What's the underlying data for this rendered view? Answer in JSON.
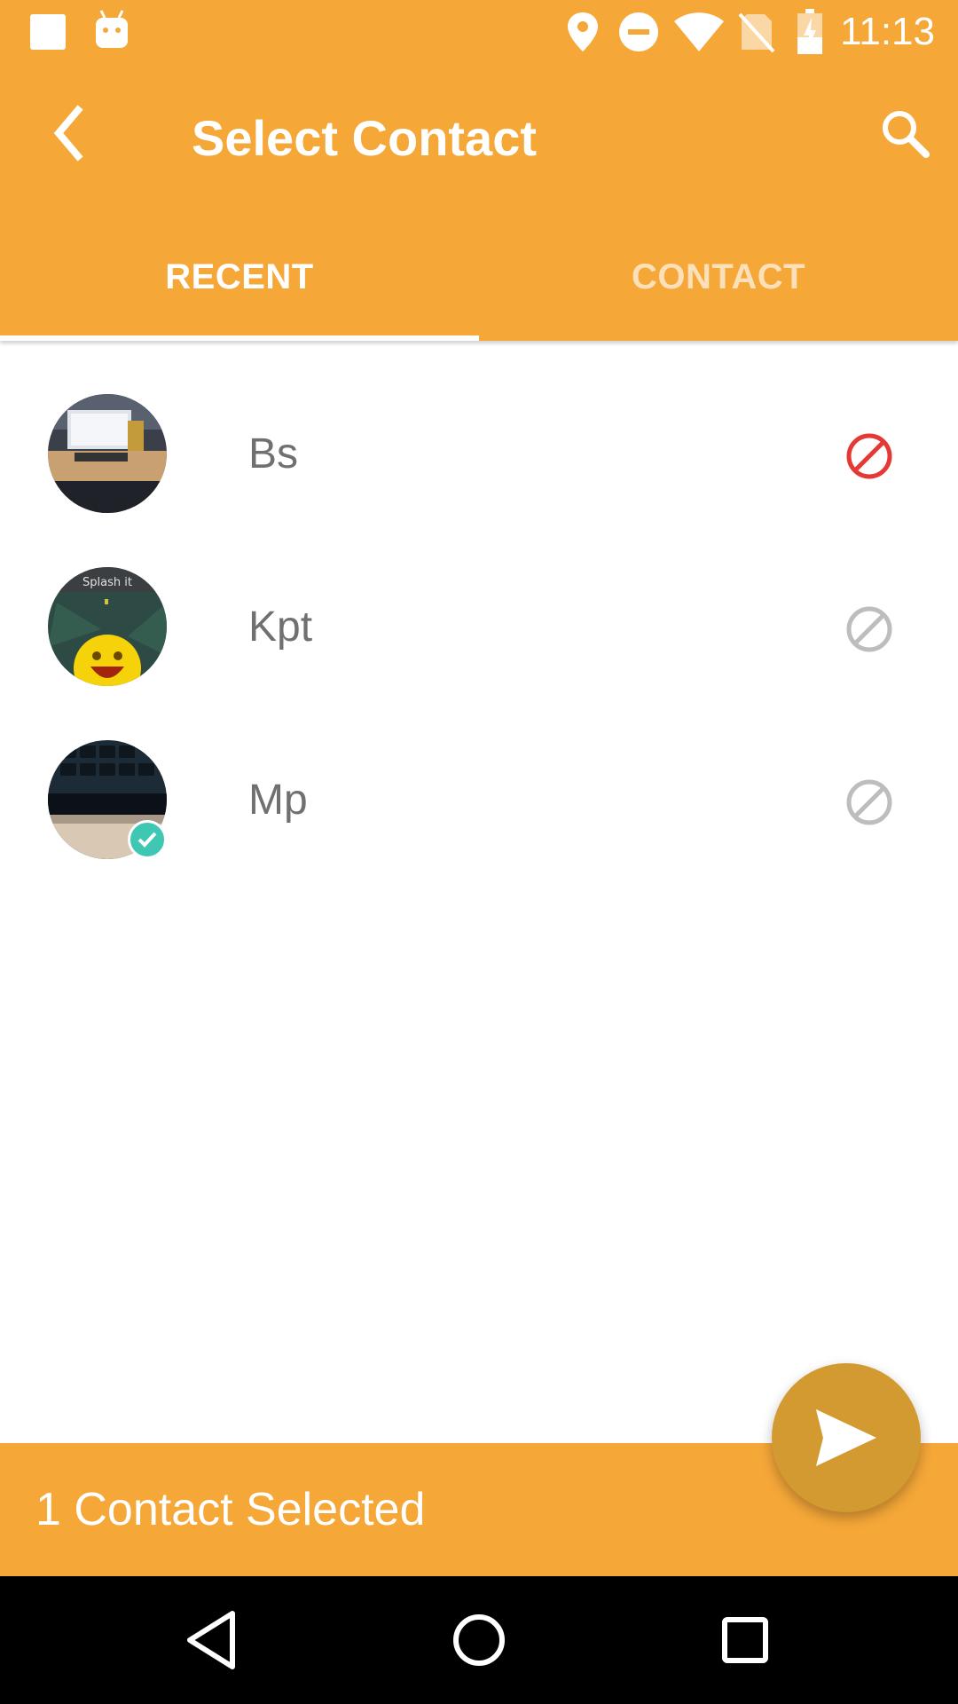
{
  "status_bar": {
    "time": "11:13",
    "icons": [
      "square-notification-icon",
      "android-icon",
      "location-icon",
      "do-not-disturb-icon",
      "wifi-icon",
      "no-sim-icon",
      "battery-charging-icon"
    ]
  },
  "toolbar": {
    "title": "Select Contact",
    "back_icon": "back-arrow-icon",
    "search_icon": "search-icon"
  },
  "tabs": [
    {
      "label": "RECENT",
      "active": true
    },
    {
      "label": "CONTACT",
      "active": false
    }
  ],
  "contacts": [
    {
      "name": "Bs",
      "blocked": true,
      "selected": false,
      "avatar": "desk-photo"
    },
    {
      "name": "Kpt",
      "blocked": false,
      "selected": false,
      "avatar": "emoji-photo"
    },
    {
      "name": "Mp",
      "blocked": false,
      "selected": true,
      "avatar": "keyboard-photo"
    }
  ],
  "avatar_caption": "Splash it",
  "selection_bar": {
    "text": "1 Contact Selected"
  },
  "fab": {
    "icon": "send-icon"
  },
  "colors": {
    "primary": "#F5A738",
    "fab": "#D49A32",
    "blocked": "#E53935",
    "unblocked": "#BDBDBD",
    "selected_badge": "#3EC7B3",
    "name_text": "#707070"
  }
}
